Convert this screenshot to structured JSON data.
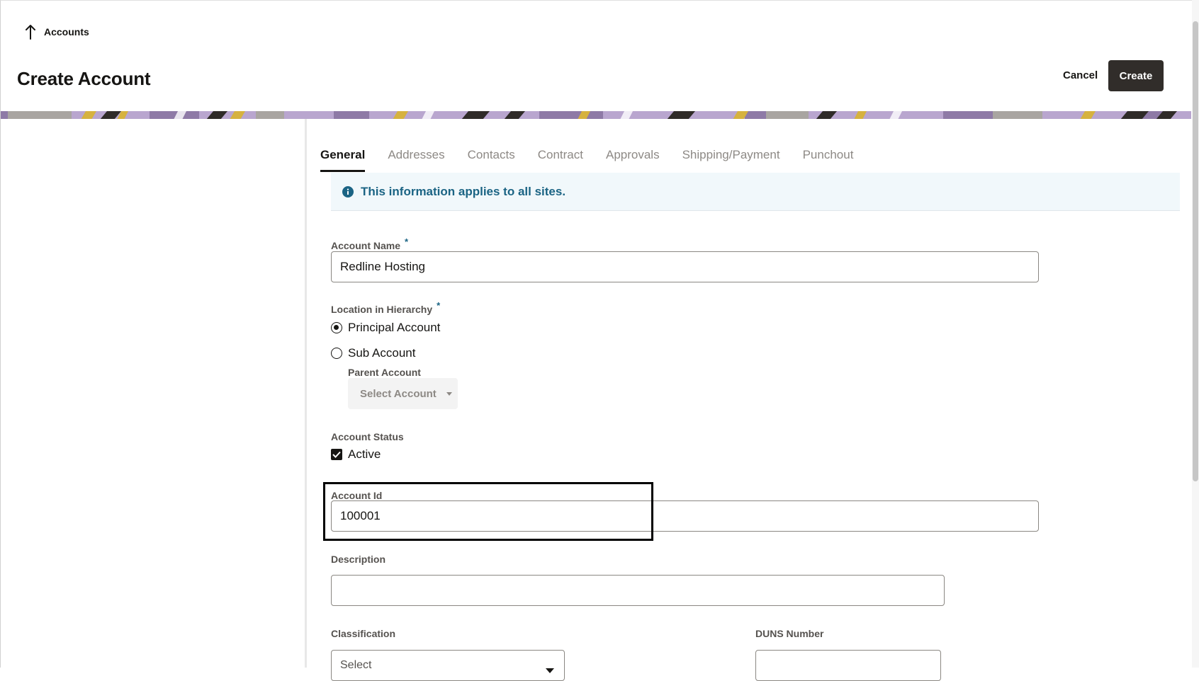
{
  "header": {
    "back_label": "Accounts",
    "page_title": "Create Account",
    "cancel_label": "Cancel",
    "create_label": "Create"
  },
  "tabs": [
    {
      "label": "General",
      "active": true
    },
    {
      "label": "Addresses",
      "active": false
    },
    {
      "label": "Contacts",
      "active": false
    },
    {
      "label": "Contract",
      "active": false
    },
    {
      "label": "Approvals",
      "active": false
    },
    {
      "label": "Shipping/Payment",
      "active": false
    },
    {
      "label": "Punchout",
      "active": false
    }
  ],
  "info": {
    "text": "This information applies to all sites.",
    "icon": "info-icon",
    "color": "#1b6484"
  },
  "form": {
    "account_name": {
      "label": "Account Name",
      "required_mark": "*",
      "value": "Redline Hosting"
    },
    "location": {
      "label": "Location in Hierarchy",
      "required_mark": "*",
      "options": [
        {
          "label": "Principal Account",
          "selected": true
        },
        {
          "label": "Sub Account",
          "selected": false
        }
      ],
      "parent_label": "Parent Account",
      "parent_placeholder": "Select Account"
    },
    "status": {
      "label": "Account Status",
      "checkbox_label": "Active",
      "checked": true
    },
    "account_id": {
      "label": "Account Id",
      "value": "100001"
    },
    "description": {
      "label": "Description",
      "value": ""
    },
    "classification": {
      "label": "Classification",
      "value": "Select"
    },
    "duns": {
      "label": "DUNS Number",
      "value": ""
    }
  },
  "colors": {
    "primary_button": "#312d2a",
    "accent": "#1b6484"
  }
}
